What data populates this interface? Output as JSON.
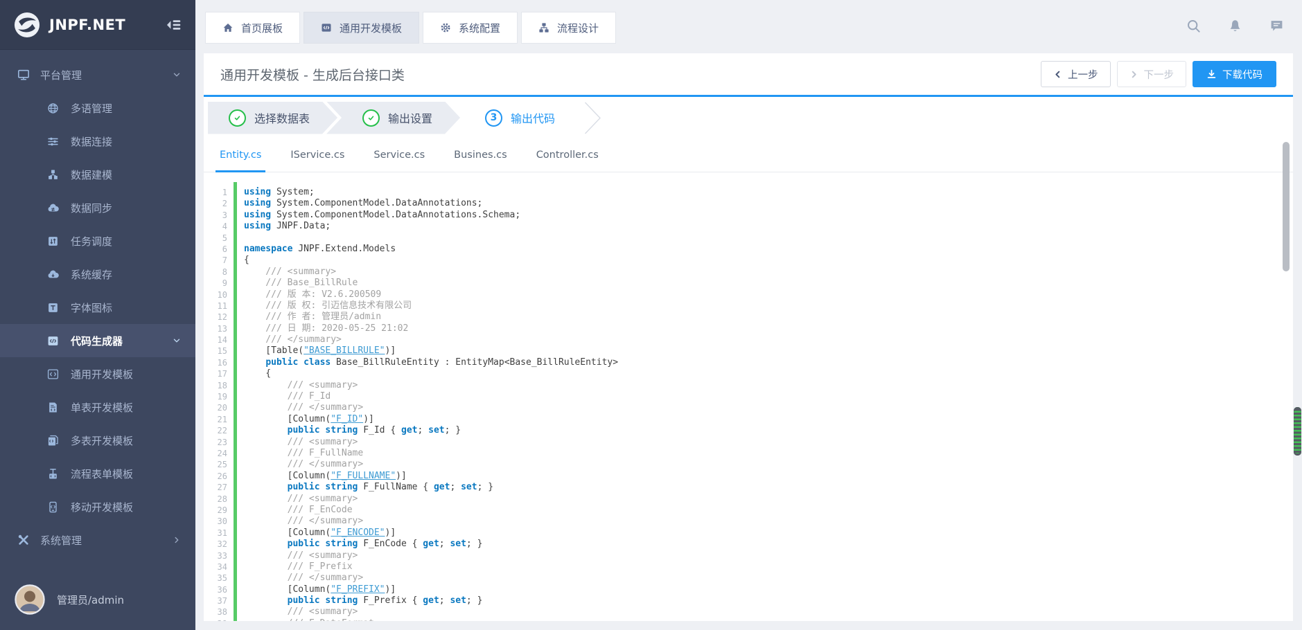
{
  "colors": {
    "accent": "#2196f3",
    "success": "#26bf4a",
    "sidebar": "#3d475f",
    "gutter_green": "#57cb66"
  },
  "sidebar": {
    "logo_text": "JNPF.NET",
    "items": [
      {
        "label": "平台管理",
        "icon": "monitor-icon",
        "level": 1,
        "chevron": "down"
      },
      {
        "label": "多语管理",
        "icon": "globe-icon",
        "level": 2
      },
      {
        "label": "数据连接",
        "icon": "sliders-icon",
        "level": 2
      },
      {
        "label": "数据建模",
        "icon": "cubes-icon",
        "level": 2
      },
      {
        "label": "数据同步",
        "icon": "cloud-sync-icon",
        "level": 2
      },
      {
        "label": "任务调度",
        "icon": "schedule-icon",
        "level": 2
      },
      {
        "label": "系统缓存",
        "icon": "cloud-cache-icon",
        "level": 2
      },
      {
        "label": "字体图标",
        "icon": "font-icon",
        "level": 2
      },
      {
        "label": "代码生成器",
        "icon": "code-square-icon",
        "level": 2,
        "active": true,
        "chevron": "down"
      },
      {
        "label": "通用开发模板",
        "icon": "code-tag-icon",
        "level": 2
      },
      {
        "label": "单表开发模板",
        "icon": "doc-code-icon",
        "level": 2
      },
      {
        "label": "多表开发模板",
        "icon": "docs-code-icon",
        "level": 2
      },
      {
        "label": "流程表单模板",
        "icon": "flow-form-icon",
        "level": 2
      },
      {
        "label": "移动开发模板",
        "icon": "mobile-icon",
        "level": 2
      },
      {
        "label": "系统管理",
        "icon": "tools-icon",
        "level": 1,
        "chevron": "right"
      }
    ],
    "user": {
      "name": "管理员/admin"
    }
  },
  "topbar": {
    "tabs": [
      {
        "label": "首页展板",
        "icon": "home-icon"
      },
      {
        "label": "通用开发模板",
        "icon": "code-filled-icon",
        "active": true
      },
      {
        "label": "系统配置",
        "icon": "gear-icon"
      },
      {
        "label": "流程设计",
        "icon": "flow-icon"
      }
    ],
    "actions": [
      "search-icon",
      "bell-icon",
      "message-icon"
    ]
  },
  "page": {
    "title": "通用开发模板 - 生成后台接口类",
    "buttons": {
      "prev": "上一步",
      "next": "下一步",
      "download": "下载代码"
    }
  },
  "steps": [
    {
      "label": "选择数据表",
      "status": "done"
    },
    {
      "label": "输出设置",
      "status": "done"
    },
    {
      "label": "输出代码",
      "status": "current",
      "number": "3"
    }
  ],
  "code_tabs": {
    "items": [
      "Entity.cs",
      "IService.cs",
      "Service.cs",
      "Busines.cs",
      "Controller.cs"
    ],
    "active": 0
  },
  "code": {
    "lines": [
      [
        [
          "k",
          "using"
        ],
        [
          "p",
          " System;"
        ]
      ],
      [
        [
          "k",
          "using"
        ],
        [
          "p",
          " System.ComponentModel.DataAnnotations;"
        ]
      ],
      [
        [
          "k",
          "using"
        ],
        [
          "p",
          " System.ComponentModel.DataAnnotations.Schema;"
        ]
      ],
      [
        [
          "k",
          "using"
        ],
        [
          "p",
          " JNPF.Data;"
        ]
      ],
      [],
      [
        [
          "k",
          "namespace"
        ],
        [
          "p",
          " JNPF.Extend.Models"
        ]
      ],
      [
        [
          "p",
          "{"
        ]
      ],
      [
        [
          "c",
          "    /// <summary>"
        ]
      ],
      [
        [
          "c",
          "    /// Base_BillRule"
        ]
      ],
      [
        [
          "c",
          "    /// 版 本: V2.6.200509"
        ]
      ],
      [
        [
          "c",
          "    /// 版 权: 引迈信息技术有限公司"
        ]
      ],
      [
        [
          "c",
          "    /// 作 者: 管理员/admin"
        ]
      ],
      [
        [
          "c",
          "    /// 日 期: 2020-05-25 21:02"
        ]
      ],
      [
        [
          "c",
          "    /// </summary>"
        ]
      ],
      [
        [
          "p",
          "    [Table("
        ],
        [
          "s",
          "\"BASE_BILLRULE\""
        ],
        [
          "p",
          ")]"
        ]
      ],
      [
        [
          "p",
          "    "
        ],
        [
          "k",
          "public class"
        ],
        [
          "p",
          " Base_BillRuleEntity : EntityMap<Base_BillRuleEntity>"
        ]
      ],
      [
        [
          "p",
          "    {"
        ]
      ],
      [
        [
          "c",
          "        /// <summary>"
        ]
      ],
      [
        [
          "c",
          "        /// F_Id"
        ]
      ],
      [
        [
          "c",
          "        /// </summary>"
        ]
      ],
      [
        [
          "p",
          "        [Column("
        ],
        [
          "s",
          "\"F_ID\""
        ],
        [
          "p",
          ")]"
        ]
      ],
      [
        [
          "p",
          "        "
        ],
        [
          "k",
          "public string"
        ],
        [
          "p",
          " F_Id { "
        ],
        [
          "k",
          "get"
        ],
        [
          "p",
          "; "
        ],
        [
          "k",
          "set"
        ],
        [
          "p",
          "; }"
        ]
      ],
      [
        [
          "c",
          "        /// <summary>"
        ]
      ],
      [
        [
          "c",
          "        /// F_FullName"
        ]
      ],
      [
        [
          "c",
          "        /// </summary>"
        ]
      ],
      [
        [
          "p",
          "        [Column("
        ],
        [
          "s",
          "\"F_FULLNAME\""
        ],
        [
          "p",
          ")]"
        ]
      ],
      [
        [
          "p",
          "        "
        ],
        [
          "k",
          "public string"
        ],
        [
          "p",
          " F_FullName { "
        ],
        [
          "k",
          "get"
        ],
        [
          "p",
          "; "
        ],
        [
          "k",
          "set"
        ],
        [
          "p",
          "; }"
        ]
      ],
      [
        [
          "c",
          "        /// <summary>"
        ]
      ],
      [
        [
          "c",
          "        /// F_EnCode"
        ]
      ],
      [
        [
          "c",
          "        /// </summary>"
        ]
      ],
      [
        [
          "p",
          "        [Column("
        ],
        [
          "s",
          "\"F_ENCODE\""
        ],
        [
          "p",
          ")]"
        ]
      ],
      [
        [
          "p",
          "        "
        ],
        [
          "k",
          "public string"
        ],
        [
          "p",
          " F_EnCode { "
        ],
        [
          "k",
          "get"
        ],
        [
          "p",
          "; "
        ],
        [
          "k",
          "set"
        ],
        [
          "p",
          "; }"
        ]
      ],
      [
        [
          "c",
          "        /// <summary>"
        ]
      ],
      [
        [
          "c",
          "        /// F_Prefix"
        ]
      ],
      [
        [
          "c",
          "        /// </summary>"
        ]
      ],
      [
        [
          "p",
          "        [Column("
        ],
        [
          "s",
          "\"F_PREFIX\""
        ],
        [
          "p",
          ")]"
        ]
      ],
      [
        [
          "p",
          "        "
        ],
        [
          "k",
          "public string"
        ],
        [
          "p",
          " F_Prefix { "
        ],
        [
          "k",
          "get"
        ],
        [
          "p",
          "; "
        ],
        [
          "k",
          "set"
        ],
        [
          "p",
          "; }"
        ]
      ],
      [
        [
          "c",
          "        /// <summary>"
        ]
      ],
      [
        [
          "c",
          "        /// F_DateFormat"
        ]
      ]
    ]
  }
}
